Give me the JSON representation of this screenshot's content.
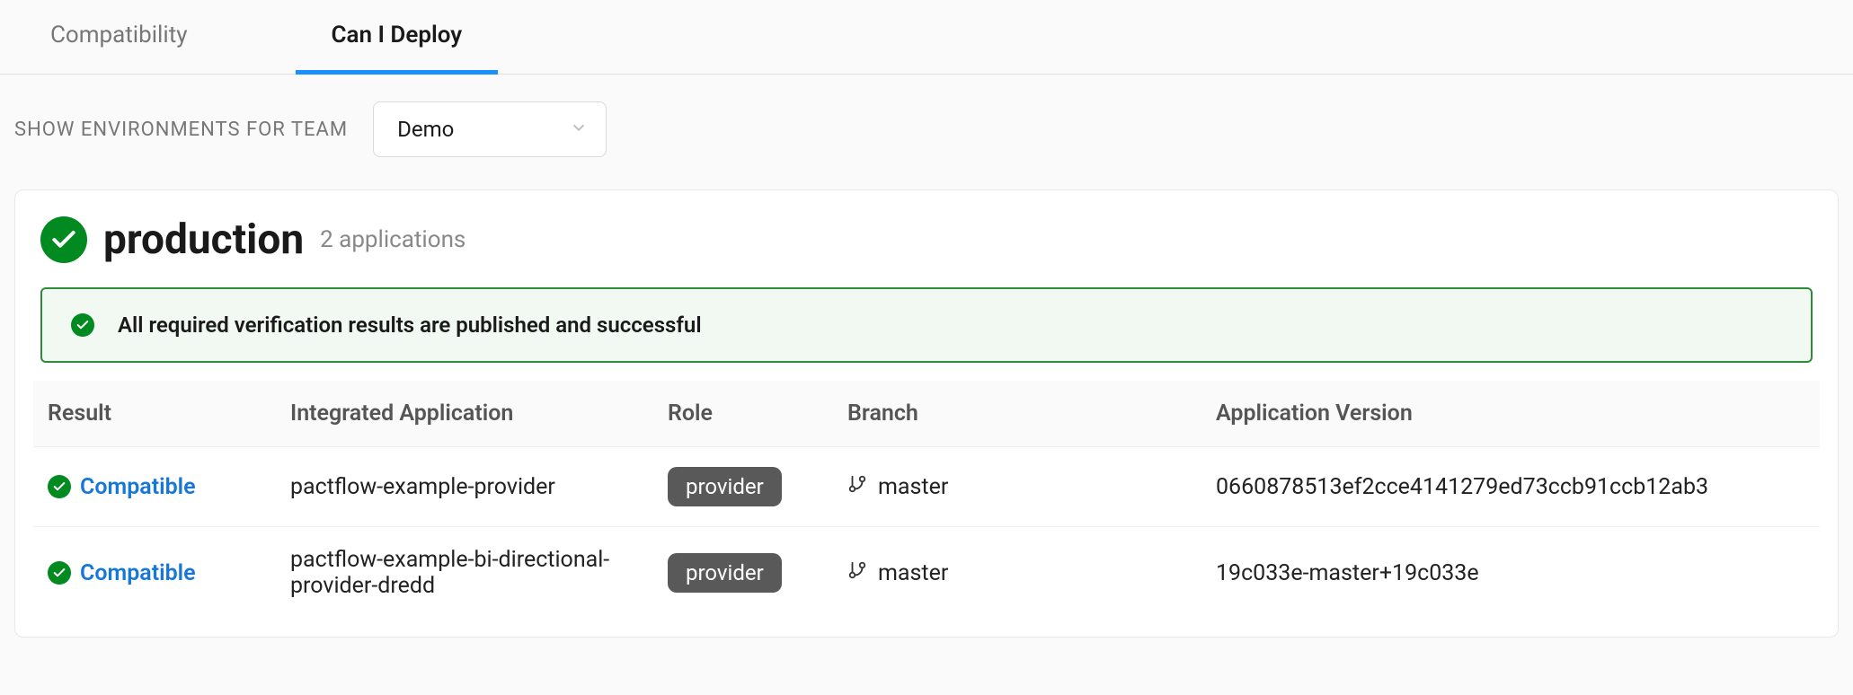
{
  "tabs": {
    "compatibility": "Compatibility",
    "can_i_deploy": "Can I Deploy"
  },
  "filter": {
    "label": "SHOW ENVIRONMENTS FOR TEAM",
    "selected": "Demo"
  },
  "environment": {
    "name": "production",
    "subtitle": "2 applications"
  },
  "alert": {
    "message": "All required verification results are published and successful"
  },
  "table": {
    "headers": {
      "result": "Result",
      "application": "Integrated Application",
      "role": "Role",
      "branch": "Branch",
      "version": "Application Version"
    },
    "rows": [
      {
        "result": "Compatible",
        "application": "pactflow-example-provider",
        "role": "provider",
        "branch": "master",
        "version": "0660878513ef2cce4141279ed73ccb91ccb12ab3"
      },
      {
        "result": "Compatible",
        "application": "pactflow-example-bi-directional-provider-dredd",
        "role": "provider",
        "branch": "master",
        "version": "19c033e-master+19c033e"
      }
    ]
  }
}
